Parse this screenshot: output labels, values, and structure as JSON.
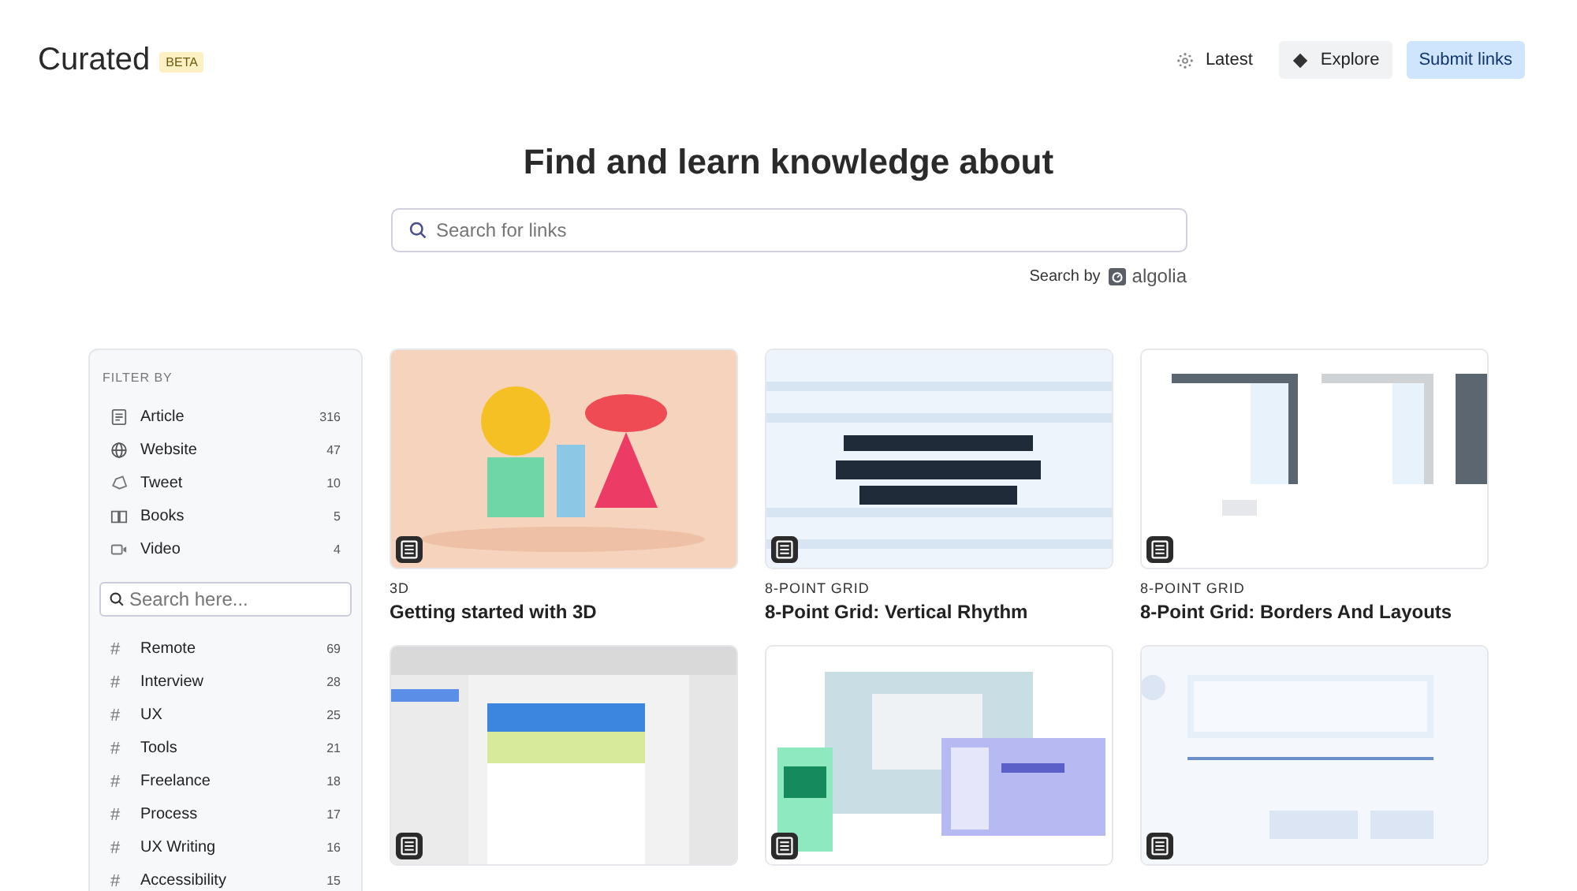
{
  "brand": {
    "name": "Curated",
    "badge": "BETA"
  },
  "nav": [
    {
      "label": "Latest",
      "kind": "latest"
    },
    {
      "label": "Explore",
      "kind": "explore"
    },
    {
      "label": "Submit links",
      "kind": "primary"
    }
  ],
  "hero": {
    "title": "Find and learn knowledge about",
    "search": {
      "placeholder": "Search for links"
    },
    "search_by": "Search by",
    "provider": "algolia"
  },
  "sidebar": {
    "heading": "FILTER BY",
    "types": [
      {
        "label": "Article",
        "count": "316"
      },
      {
        "label": "Website",
        "count": "47"
      },
      {
        "label": "Tweet",
        "count": "10"
      },
      {
        "label": "Books",
        "count": "5"
      },
      {
        "label": "Video",
        "count": "4"
      }
    ],
    "search": {
      "placeholder": "Search here..."
    },
    "tags": [
      {
        "symbol": "#",
        "label": "Remote",
        "count": "69"
      },
      {
        "symbol": "#",
        "label": "Interview",
        "count": "28"
      },
      {
        "symbol": "#",
        "label": "UX",
        "count": "25"
      },
      {
        "symbol": "#",
        "label": "Tools",
        "count": "21"
      },
      {
        "symbol": "#",
        "label": "Freelance",
        "count": "18"
      },
      {
        "symbol": "#",
        "label": "Process",
        "count": "17"
      },
      {
        "symbol": "#",
        "label": "UX Writing",
        "count": "16"
      },
      {
        "symbol": "#",
        "label": "Accessibility",
        "count": "15"
      }
    ]
  },
  "cards": [
    {
      "thumbnail": {
        "kind": "picture"
      },
      "category": "3D",
      "title": "Getting started with 3D"
    },
    {
      "thumbnail": {
        "kind": "picture"
      },
      "category": "8-POINT GRID",
      "title": "8-Point Grid: Vertical Rhythm"
    },
    {
      "thumbnail": {
        "kind": "picture"
      },
      "category": "8-POINT GRID",
      "title": "8-Point Grid: Borders And Layouts"
    },
    {
      "thumbnail": {
        "kind": "picture"
      }
    },
    {
      "thumbnail": {
        "kind": "picture"
      }
    },
    {
      "thumbnail": {
        "kind": "picture"
      }
    }
  ]
}
